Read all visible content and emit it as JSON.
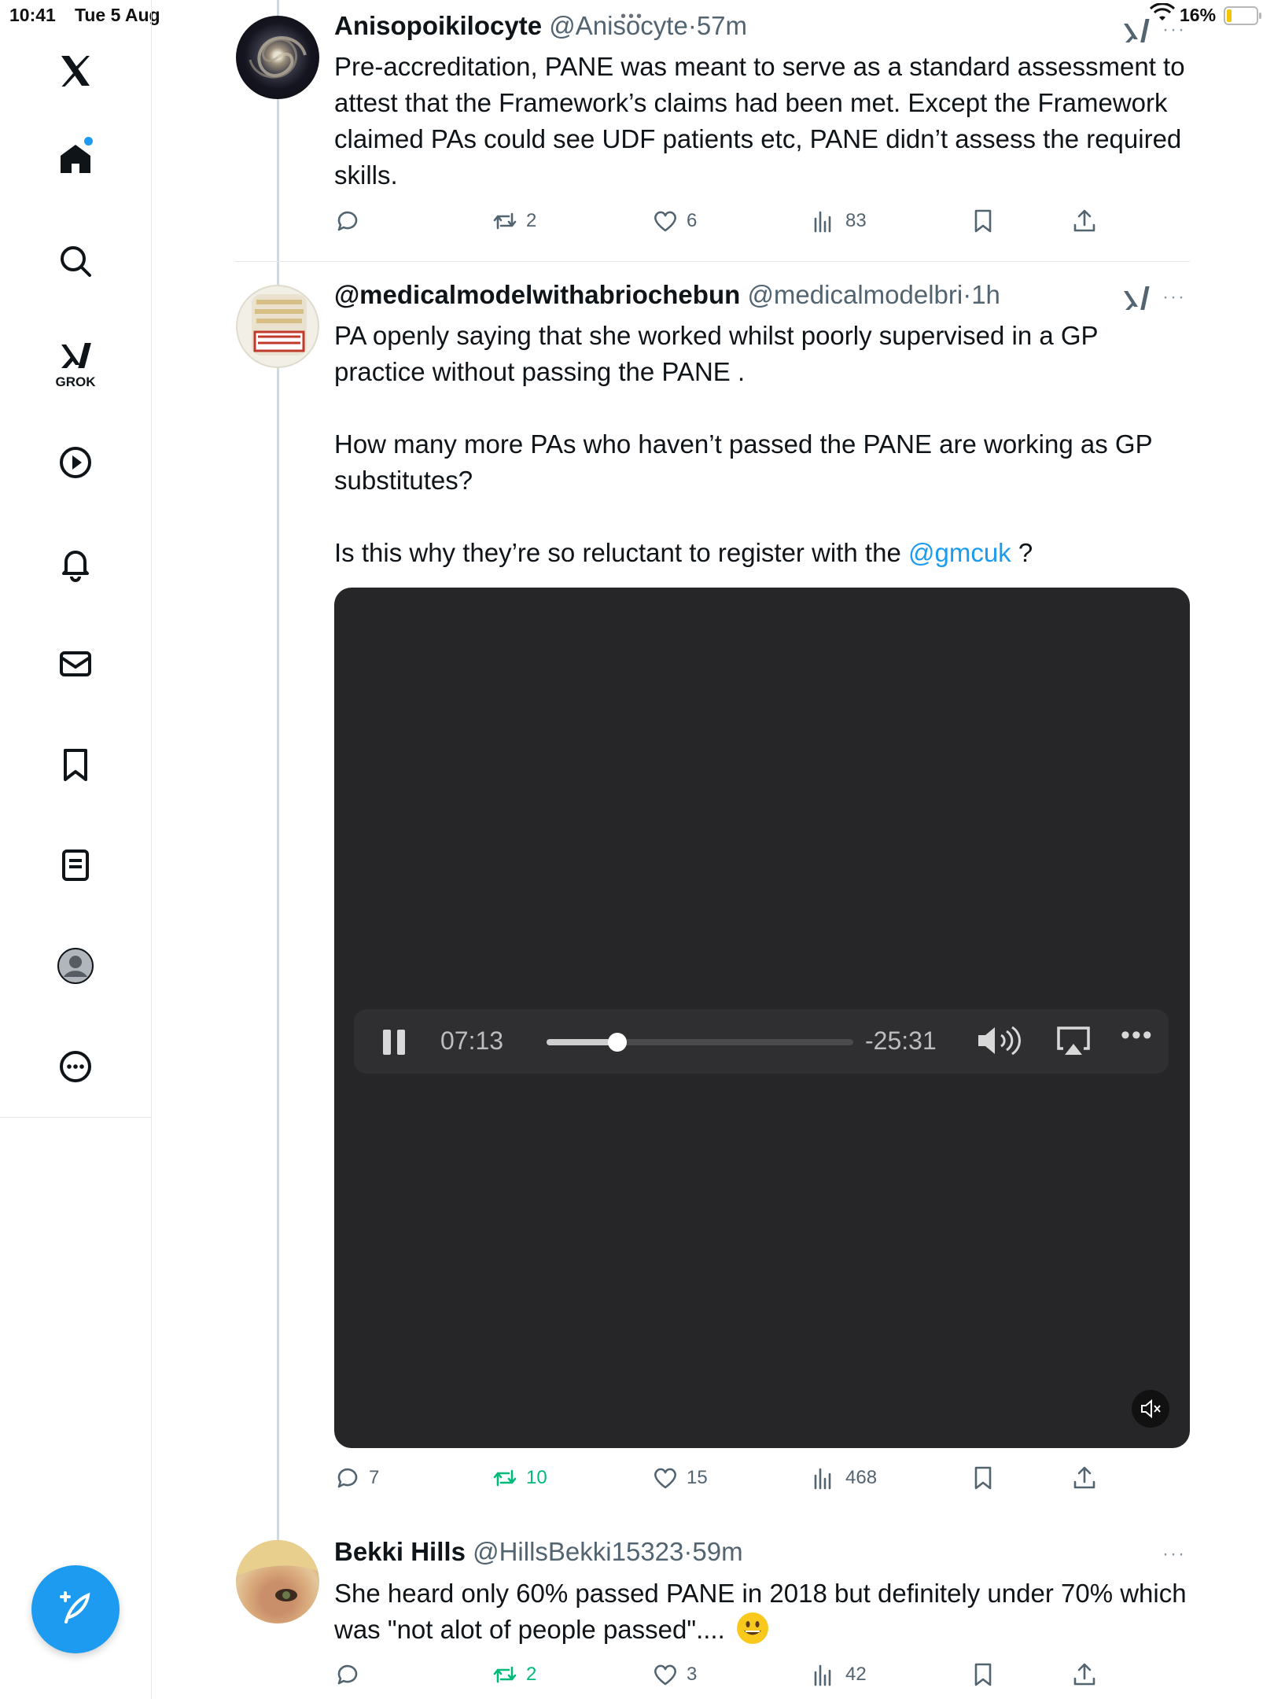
{
  "status_bar": {
    "time": "10:41",
    "date": "Tue 5 Aug",
    "battery_percent": "16%",
    "battery_level": 0.16
  },
  "sidebar": {
    "items": [
      {
        "name": "x-logo",
        "icon": "x-logo-icon"
      },
      {
        "name": "home",
        "icon": "home-icon",
        "active": true,
        "has_notification_dot": true
      },
      {
        "name": "search",
        "icon": "search-icon"
      },
      {
        "name": "grok",
        "icon": "grok-icon",
        "label": "GROK"
      },
      {
        "name": "videos",
        "icon": "play-icon"
      },
      {
        "name": "notifications",
        "icon": "bell-icon"
      },
      {
        "name": "messages",
        "icon": "mail-icon"
      },
      {
        "name": "bookmarks",
        "icon": "bookmark-icon"
      },
      {
        "name": "lists",
        "icon": "list-icon"
      },
      {
        "name": "profile",
        "icon": "profile-icon"
      },
      {
        "name": "more",
        "icon": "more-circle-icon"
      }
    ],
    "compose_icon": "compose-feather-icon"
  },
  "colors": {
    "accent": "#1d9bf0",
    "retweet_green": "#00ba7c",
    "muted": "#536471"
  },
  "tweets": [
    {
      "name": "Anisopoikilocyte",
      "handle": "@Anisocyte",
      "separator": "·",
      "time": "57m",
      "text": "Pre-accreditation, PANE was meant to serve as a standard assessment to attest that the Framework’s claims had been met. Except the Framework claimed PAs could see UDF patients etc, PANE didn’t assess the required skills.",
      "replies": "",
      "retweets": "2",
      "likes": "6",
      "views": "83"
    },
    {
      "name": "@medicalmodelwithabriochebun",
      "handle": "@medicalmodelbri",
      "separator": "·",
      "time": "1h",
      "paragraphs": [
        "PA openly saying that she worked whilst poorly supervised in a GP practice  without passing the PANE .",
        "How many more PAs who haven’t passed the PANE are working as GP substitutes?"
      ],
      "last_line_prefix": "Is this why they’re so reluctant to register with the ",
      "mention": "@gmcuk",
      "last_line_suffix": " ?",
      "video": {
        "elapsed": "07:13",
        "remaining": "-25:31",
        "progress": 0.23,
        "muted": true
      },
      "replies": "7",
      "retweets": "10",
      "likes": "15",
      "views": "468"
    },
    {
      "name": "Bekki Hills",
      "handle": "@HillsBekki15323",
      "separator": "·",
      "time": "59m",
      "text": "She heard only 60% passed PANE in 2018 but definitely under 70% which was \"not alot of people passed\"....",
      "emoji": "grinning-face-emoji",
      "replies": "",
      "retweets": "2",
      "likes": "3",
      "views": "42"
    }
  ]
}
